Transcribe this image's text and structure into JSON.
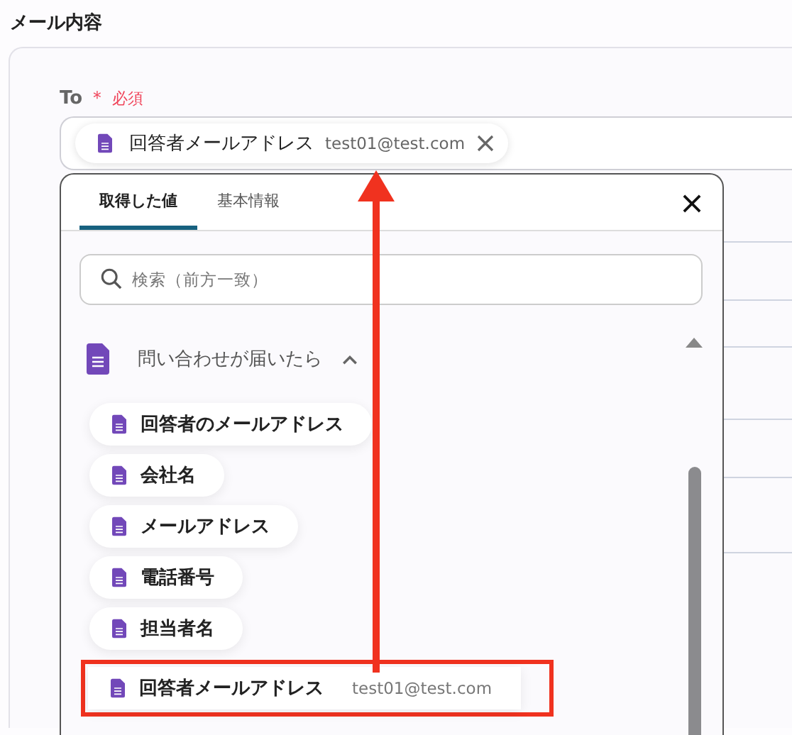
{
  "section_title": "メール内容",
  "to_field": {
    "label": "To",
    "required_mark": "＊",
    "required_text": "必須",
    "chip": {
      "label": "回答者メールアドレス",
      "value": "test01@test.com"
    }
  },
  "panel": {
    "tabs": [
      {
        "label": "取得した値",
        "selected": true
      },
      {
        "label": "基本情報",
        "selected": false
      }
    ],
    "search": {
      "placeholder": "検索（前方一致）"
    },
    "group": {
      "title": "問い合わせが届いたら",
      "expanded": true
    },
    "items": [
      {
        "label": "回答者のメールアドレス",
        "value": "",
        "highlighted": false
      },
      {
        "label": "会社名",
        "value": "",
        "highlighted": false
      },
      {
        "label": "メールアドレス",
        "value": "",
        "highlighted": false
      },
      {
        "label": "電話番号",
        "value": "",
        "highlighted": false
      },
      {
        "label": "担当者名",
        "value": "",
        "highlighted": false
      },
      {
        "label": "回答者メールアドレス",
        "value": "test01@test.com",
        "highlighted": true
      }
    ]
  }
}
